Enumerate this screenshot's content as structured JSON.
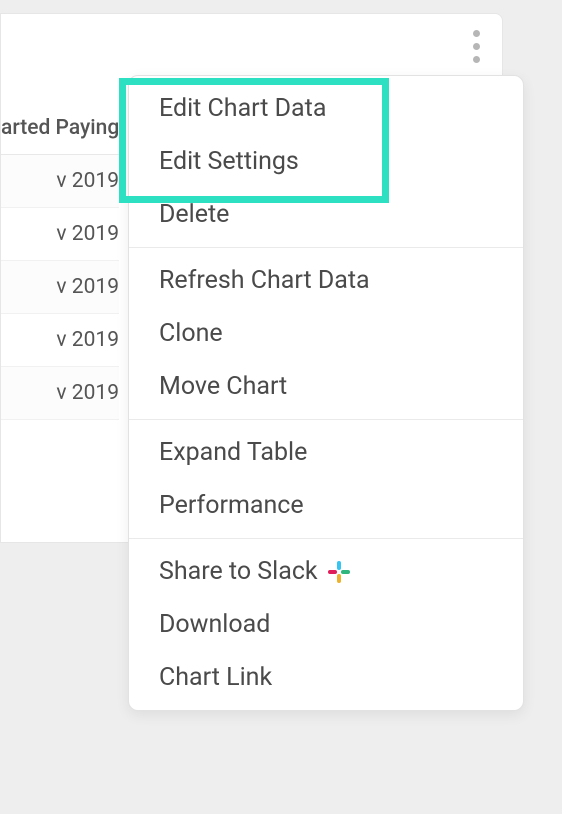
{
  "table": {
    "column_header": "arted Paying",
    "rows": [
      "v 2019",
      "v 2019",
      "v 2019",
      "v 2019",
      "v 2019"
    ]
  },
  "menu": {
    "groups": [
      [
        {
          "label": "Edit Chart Data",
          "name": "menu-item-edit-chart-data"
        },
        {
          "label": "Edit Settings",
          "name": "menu-item-edit-settings"
        },
        {
          "label": "Delete",
          "name": "menu-item-delete"
        }
      ],
      [
        {
          "label": "Refresh Chart Data",
          "name": "menu-item-refresh-chart-data"
        },
        {
          "label": "Clone",
          "name": "menu-item-clone"
        },
        {
          "label": "Move Chart",
          "name": "menu-item-move-chart"
        }
      ],
      [
        {
          "label": "Expand Table",
          "name": "menu-item-expand-table"
        },
        {
          "label": "Performance",
          "name": "menu-item-performance"
        }
      ],
      [
        {
          "label": "Share to Slack",
          "name": "menu-item-share-to-slack",
          "icon": "slack"
        },
        {
          "label": "Download",
          "name": "menu-item-download"
        },
        {
          "label": "Chart Link",
          "name": "menu-item-chart-link"
        }
      ]
    ]
  }
}
